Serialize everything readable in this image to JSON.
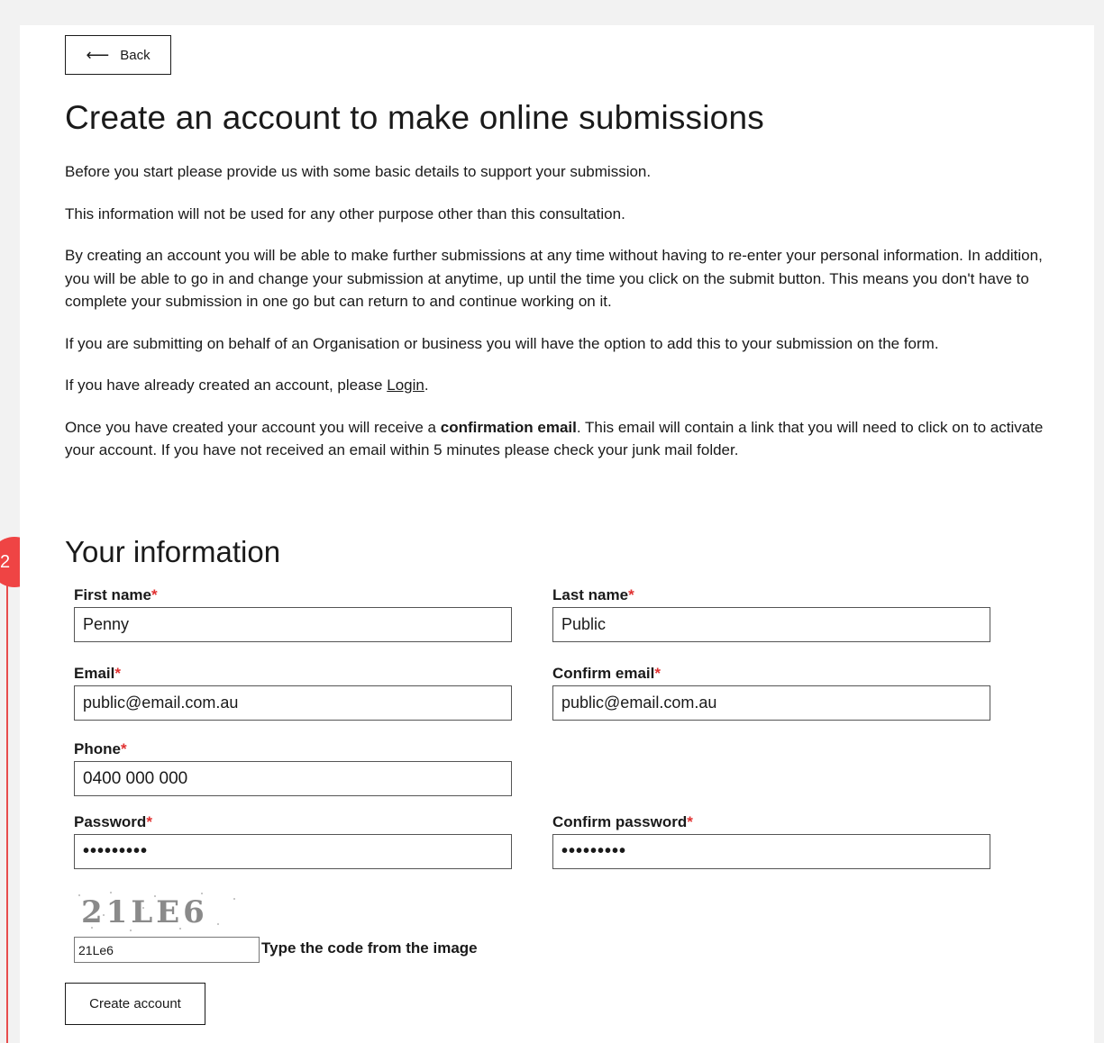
{
  "nav": {
    "back_label": "Back"
  },
  "page_title": "Create an account to make online submissions",
  "intro": {
    "p1": "Before you start please provide us with some basic details to support your submission.",
    "p2": "This information will not be used for any other purpose other than this consultation.",
    "p3": "By creating an account you will be able to make further submissions at any time without having to re-enter your personal information. In addition, you will be able to go in and change your submission at anytime, up until the time you click on the submit button. This means you don't have to complete your submission in one go but can return to and continue working on it.",
    "p4": "If you are submitting on behalf of an Organisation or business you will have the option to add this to your submission on the form.",
    "p5_prefix": "If you have already created an account, please ",
    "p5_link": "Login",
    "p5_suffix": ".",
    "p6_prefix": "Once you have created your account you will receive a ",
    "p6_bold": "confirmation email",
    "p6_suffix": ". This email will contain a link that you will need to click on to activate your account. If you have not received an email within 5 minutes please check your junk mail folder."
  },
  "step_badge": "2",
  "section_title": "Your information",
  "form": {
    "required_marker": "*",
    "first_name": {
      "label": "First name",
      "value": "Penny"
    },
    "last_name": {
      "label": "Last name",
      "value": "Public"
    },
    "email": {
      "label": "Email",
      "value": "public@email.com.au"
    },
    "confirm_email": {
      "label": "Confirm email",
      "value": "public@email.com.au"
    },
    "phone": {
      "label": "Phone",
      "value": "0400 000 000"
    },
    "password": {
      "label": "Password",
      "value": "•••••••••"
    },
    "confirm_password": {
      "label": "Confirm password",
      "value": "•••••••••"
    },
    "captcha": {
      "image_text": "21LE6",
      "value": "21Le6",
      "label": "Type the code from the image"
    },
    "submit_label": "Create account"
  },
  "colors": {
    "accent_red": "#ef4444",
    "required_red": "#e03131",
    "text": "#1a1a1a"
  }
}
